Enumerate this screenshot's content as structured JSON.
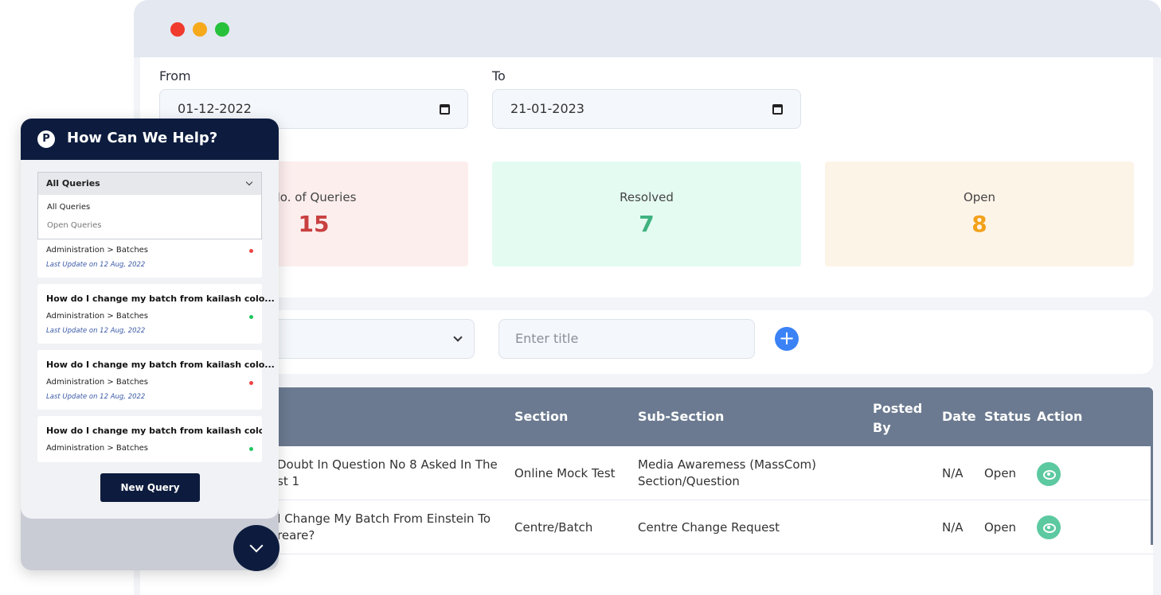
{
  "filters": {
    "from_label": "From",
    "from_value": "01-12-2022",
    "to_label": "To",
    "to_value": "21-01-2023"
  },
  "stats": {
    "total_label": "No. of Queries",
    "total_value": "15",
    "resolved_label": "Resolved",
    "resolved_value": "7",
    "open_label": "Open",
    "open_value": "8",
    "colors": {
      "total": "#c94040",
      "resolved": "#3fb27f",
      "open": "#f2a11a"
    }
  },
  "search": {
    "title_placeholder": "Enter title"
  },
  "table": {
    "headers": {
      "section": "Section",
      "subsection": "Sub-Section",
      "posted_by": "Posted By",
      "date": "Date",
      "status": "Status",
      "action": "Action"
    },
    "rows": [
      {
        "title_line1": "Doubt In Question No 8 Asked In The",
        "title_line2": "st 1",
        "section": "Online Mock Test",
        "subsection_line1": "Media Awaremess (MassCom)",
        "subsection_line2": "Section/Question",
        "date": "N/A",
        "status": "Open"
      },
      {
        "title_line1": "I Change My Batch From Einstein To",
        "title_line2": "reare?",
        "section": "Centre/Batch",
        "subsection_line1": "Centre Change Request",
        "subsection_line2": "",
        "date": "N/A",
        "status": "Open"
      }
    ]
  },
  "widget": {
    "logo_letter": "P",
    "title": "How Can We Help?",
    "select_value": "All Queries",
    "options": [
      "All Queries",
      "Open Queries"
    ],
    "queries": [
      {
        "title": "",
        "section": "Administration > Batches",
        "updated": "Last Update on 12 Aug, 2022",
        "status_color": "#ef4444"
      },
      {
        "title": "How do I change my batch from kailash colo...",
        "section": "Administration > Batches",
        "updated": "Last Update on 12 Aug, 2022",
        "status_color": "#22c55e"
      },
      {
        "title": "How do I change my batch from kailash colo...",
        "section": "Administration > Batches",
        "updated": "Last Update on 12 Aug, 2022",
        "status_color": "#ef4444"
      },
      {
        "title": "How do I change my batch from kailash colo...",
        "section": "Administration > Batches",
        "updated": "",
        "status_color": "#22c55e"
      }
    ],
    "new_query_label": "New Query"
  }
}
